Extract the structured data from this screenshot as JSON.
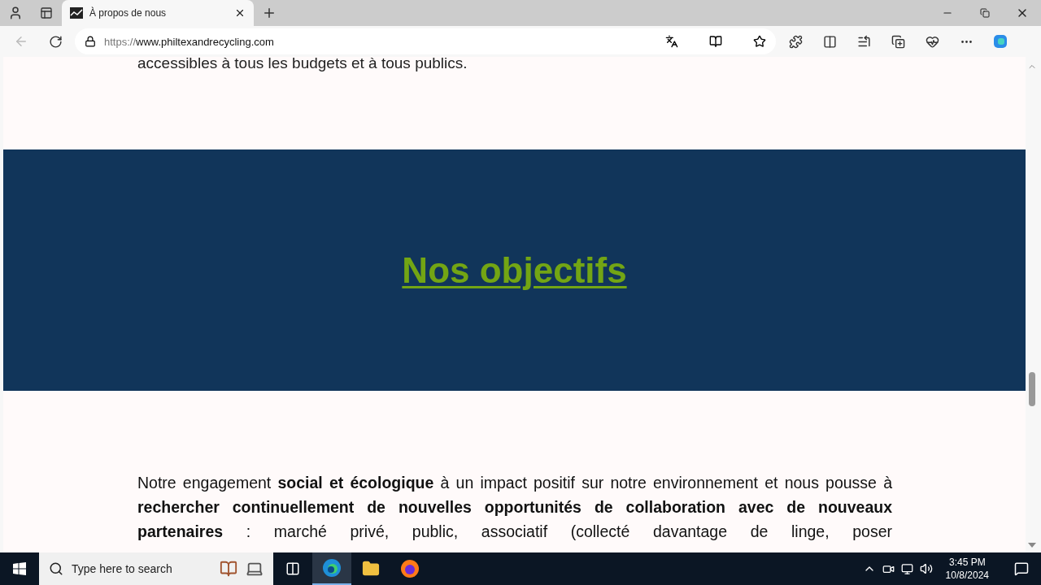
{
  "browser": {
    "tab": {
      "title": "À propos de nous",
      "selected": true
    },
    "url_scheme": "https://",
    "url_host": "www.philtexandrecycling.com"
  },
  "page": {
    "top_text": "accessibles à tous les budgets et à tous publics.",
    "banner_heading": "Nos objectifs",
    "paragraph": "Notre engagement **social et écologique** à un impact positif sur notre environnement et nous pousse à **rechercher continuellement de nouvelles opportunités de collaboration avec de nouveaux partenaires** : marché privé, public, associatif (collecté davantage de linge, poser"
  },
  "taskbar": {
    "search_placeholder": "Type here to search",
    "time": "3:45 PM",
    "date": "10/8/2024"
  }
}
